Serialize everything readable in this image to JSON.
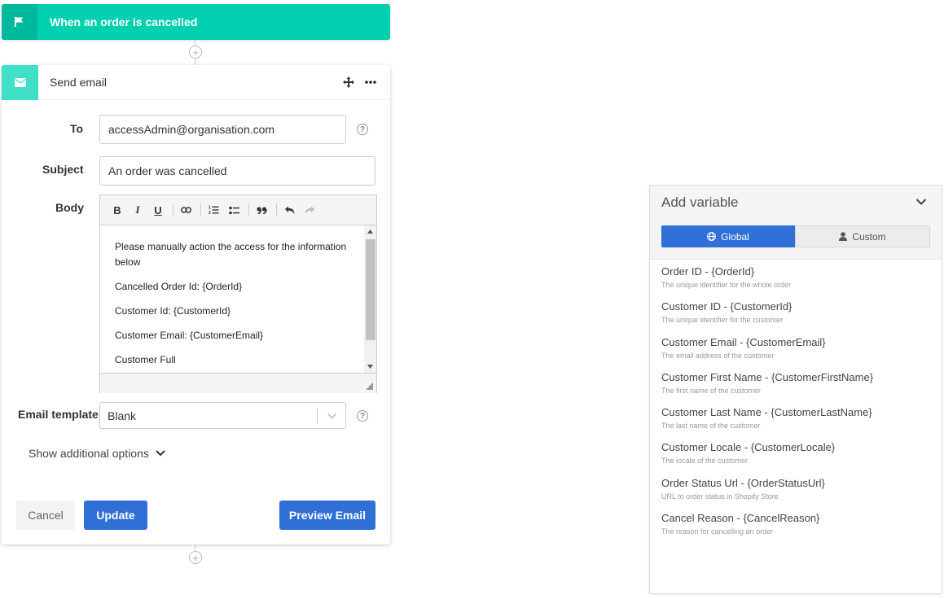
{
  "trigger": {
    "title": "When an order is cancelled",
    "icon": "flag-icon"
  },
  "action": {
    "title": "Send email",
    "icon": "envelope-icon",
    "to_label": "To",
    "to_value": "accessAdmin@organisation.com",
    "subject_label": "Subject",
    "subject_value": "An order was cancelled",
    "body_label": "Body",
    "toolbar": [
      "B",
      "I",
      "U",
      "link",
      "ordered-list",
      "bullet-list",
      "quote",
      "undo",
      "redo"
    ],
    "body_lines": [
      "Please manually action the access for the information below",
      "Cancelled Order Id: {OrderId}",
      "Customer Id: {CustomerId}",
      "Customer Email: {CustomerEmail}",
      "Customer Full"
    ],
    "template_label": "Email template",
    "template_value": "Blank",
    "show_more": "Show additional options",
    "cancel": "Cancel",
    "update": "Update",
    "preview": "Preview Email"
  },
  "variables": {
    "title": "Add variable",
    "tab_global": "Global",
    "tab_custom": "Custom",
    "items": [
      {
        "name": "Order ID - {OrderId}",
        "desc": "The unique identifier for the whole order"
      },
      {
        "name": "Customer ID - {CustomerId}",
        "desc": "The unique identifier for the customer"
      },
      {
        "name": "Customer Email - {CustomerEmail}",
        "desc": "The email address of the customer"
      },
      {
        "name": "Customer First Name - {CustomerFirstName}",
        "desc": "The first name of the customer"
      },
      {
        "name": "Customer Last Name - {CustomerLastName}",
        "desc": "The last name of the customer"
      },
      {
        "name": "Customer Locale - {CustomerLocale}",
        "desc": "The locale of the customer"
      },
      {
        "name": "Order Status Url - {OrderStatusUrl}",
        "desc": "URL to order status in Shopify Store"
      },
      {
        "name": "Cancel Reason - {CancelReason}",
        "desc": "The reason for cancelling an order"
      }
    ]
  },
  "colors": {
    "trigger": "#00cfb0",
    "action_icon": "#40e0c8",
    "primary": "#2f6fd6"
  }
}
